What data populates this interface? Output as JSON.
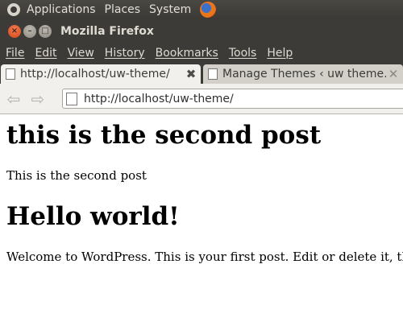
{
  "top_panel": {
    "items": [
      "Applications",
      "Places",
      "System"
    ],
    "launcher_icon": "firefox-icon"
  },
  "window": {
    "title": "Mozilla Firefox",
    "controls": {
      "close": "×",
      "minimize": "–",
      "maximize": "□"
    }
  },
  "menubar": {
    "items": [
      "File",
      "Edit",
      "View",
      "History",
      "Bookmarks",
      "Tools",
      "Help"
    ]
  },
  "tabs": [
    {
      "label": "http://localhost/uw-theme/",
      "active": true,
      "close": "✖"
    },
    {
      "label": "Manage Themes ‹ uw theme…",
      "active": false,
      "close": "✕"
    }
  ],
  "navbar": {
    "back": "⇦",
    "forward": "⇨",
    "url": "http://localhost/uw-theme/"
  },
  "page": {
    "posts": [
      {
        "title": "this is the second post",
        "body": "This is the second post"
      },
      {
        "title": "Hello world!",
        "body": "Welcome to WordPress. This is your first post. Edit or delete it, then start blogging!"
      }
    ]
  }
}
